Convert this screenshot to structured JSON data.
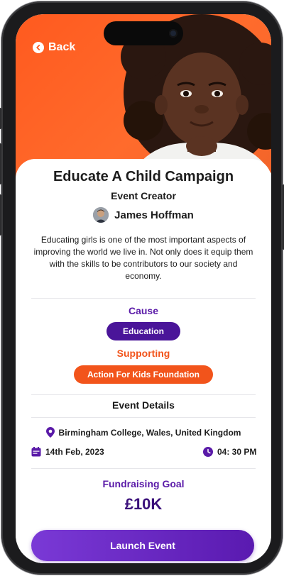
{
  "nav": {
    "back_label": "Back"
  },
  "event": {
    "title": "Educate A Child Campaign",
    "creator_heading": "Event Creator",
    "creator_name": "James Hoffman",
    "description": "Educating girls is one of the most important aspects of improving the world we live in. Not only does it equip them with the skills to be contributors to our society and economy."
  },
  "cause": {
    "label": "Cause",
    "value": "Education"
  },
  "supporting": {
    "label": "Supporting",
    "value": "Action For Kids Foundation"
  },
  "details": {
    "heading": "Event Details",
    "location": "Birmingham College, Wales, United Kingdom",
    "date": "14th Feb, 2023",
    "time": "04: 30 PM"
  },
  "goal": {
    "label": "Fundraising Goal",
    "value": "£10K"
  },
  "cta": {
    "label": "Launch Event"
  },
  "colors": {
    "accent_purple": "#5a1aa8",
    "accent_orange": "#f2541b",
    "hero_orange": "#ff5a1f"
  },
  "icons": {
    "back": "chevron-left-icon",
    "location": "location-pin-icon",
    "date": "calendar-icon",
    "time": "clock-icon"
  }
}
